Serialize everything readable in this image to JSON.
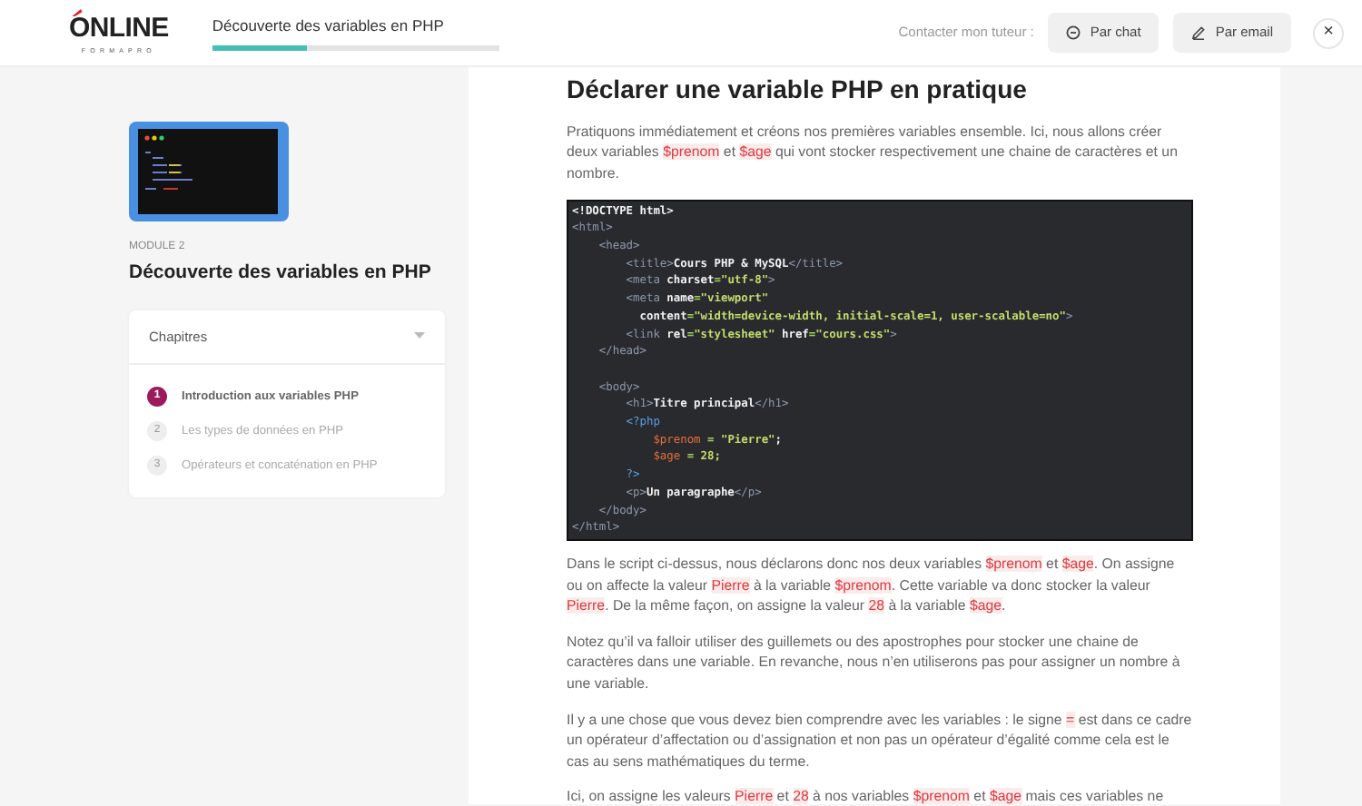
{
  "header": {
    "logo": {
      "word": "ONLINE",
      "tagline": "FORMAPRO"
    },
    "course_title": "Découverte des variables en PHP",
    "progress": {
      "level": 0.33
    },
    "contact_label": "Contacter mon tuteur :",
    "buttons": [
      {
        "kind": "chat",
        "label": "Par chat"
      },
      {
        "kind": "email",
        "label": "Par email"
      }
    ],
    "close": "×"
  },
  "sidebar": {
    "module_label": "MODULE 2",
    "module_title": "Découverte des variables en PHP",
    "chapters": {
      "title": "Chapitres",
      "expanded": true,
      "items": [
        {
          "number": "1",
          "label": "Introduction aux variables PHP",
          "selected": true
        },
        {
          "number": "2",
          "label": "Les types de données en PHP",
          "selected": false
        },
        {
          "number": "3",
          "label": "Opérateurs et concaténation en PHP",
          "selected": false
        }
      ]
    }
  },
  "article": {
    "heading": "Déclarer une variable PHP en pratique",
    "blocks": [
      {
        "kind": "paragraph",
        "parts": [
          {
            "kind": "text",
            "text": "Pratiquons immédiatement et créons nos premières variables ensemble. Ici, nous allons créer deux variables "
          },
          {
            "kind": "code",
            "text": "$prenom"
          },
          {
            "kind": "text",
            "text": " et "
          },
          {
            "kind": "code",
            "text": "$age"
          },
          {
            "kind": "text",
            "text": " qui vont stocker respectivement une chaine de caractères et un nombre."
          }
        ]
      },
      {
        "kind": "code",
        "lines": [
          [
            {
              "kind": "plain",
              "text": "<!DOCTYPE html>"
            }
          ],
          [
            {
              "kind": "tag",
              "text": "<html>"
            }
          ],
          [
            {
              "kind": "tag",
              "text": "    <head>"
            }
          ],
          [
            {
              "kind": "tag",
              "text": "        <title>"
            },
            {
              "kind": "plain",
              "text": "Cours PHP & MySQL"
            },
            {
              "kind": "tag",
              "text": "</title>"
            }
          ],
          [
            {
              "kind": "tag",
              "text": "        <meta "
            },
            {
              "kind": "plain",
              "text": "charset"
            },
            {
              "kind": "punct",
              "text": "="
            },
            {
              "kind": "string",
              "text": "\"utf-8\""
            },
            {
              "kind": "tag",
              "text": ">"
            }
          ],
          [
            {
              "kind": "tag",
              "text": "        <meta "
            },
            {
              "kind": "plain",
              "text": "name"
            },
            {
              "kind": "punct",
              "text": "="
            },
            {
              "kind": "string",
              "text": "\"viewport\""
            }
          ],
          [
            {
              "kind": "plain",
              "text": "          content"
            },
            {
              "kind": "punct",
              "text": "="
            },
            {
              "kind": "string",
              "text": "\"width=device-width, initial-scale=1, user-scalable=no\""
            },
            {
              "kind": "tag",
              "text": ">"
            }
          ],
          [
            {
              "kind": "tag",
              "text": "        <link "
            },
            {
              "kind": "plain",
              "text": "rel"
            },
            {
              "kind": "punct",
              "text": "="
            },
            {
              "kind": "string",
              "text": "\"stylesheet\""
            },
            {
              "kind": "plain",
              "text": " href"
            },
            {
              "kind": "punct",
              "text": "="
            },
            {
              "kind": "string",
              "text": "\"cours.css\""
            },
            {
              "kind": "tag",
              "text": ">"
            }
          ],
          [
            {
              "kind": "tag",
              "text": "    </head>"
            }
          ],
          [
            {
              "kind": "break"
            },
            {
              "kind": "tag",
              "text": "    <body>"
            }
          ],
          [
            {
              "kind": "tag",
              "text": "        <h1>"
            },
            {
              "kind": "plain",
              "text": "Titre principal"
            },
            {
              "kind": "tag",
              "text": "</h1>"
            }
          ],
          [
            {
              "kind": "php",
              "text": "        <?php"
            }
          ],
          [
            {
              "kind": "var",
              "text": "            $prenom"
            },
            {
              "kind": "punct",
              "text": " = "
            },
            {
              "kind": "string",
              "text": "\"Pierre\""
            },
            {
              "kind": "plain",
              "text": ";"
            }
          ],
          [
            {
              "kind": "var",
              "text": "            $age"
            },
            {
              "kind": "punct",
              "text": " = "
            },
            {
              "kind": "string",
              "text": "28;"
            }
          ],
          [
            {
              "kind": "php",
              "text": "        ?>"
            }
          ],
          [
            {
              "kind": "tag",
              "text": "        <p>"
            },
            {
              "kind": "plain",
              "text": "Un paragraphe"
            },
            {
              "kind": "tag",
              "text": "</p>"
            }
          ],
          [
            {
              "kind": "tag",
              "text": "    </body>"
            }
          ],
          [
            {
              "kind": "tag",
              "text": "</html>"
            }
          ]
        ]
      },
      {
        "kind": "paragraph",
        "parts": [
          {
            "kind": "text",
            "text": "Dans le script ci-dessus, nous déclarons donc nos deux variables "
          },
          {
            "kind": "code",
            "text": "$prenom"
          },
          {
            "kind": "text",
            "text": " et "
          },
          {
            "kind": "code",
            "text": "$age"
          },
          {
            "kind": "text",
            "text": ". On assigne ou on affecte la valeur "
          },
          {
            "kind": "code",
            "text": "Pierre"
          },
          {
            "kind": "text",
            "text": " à la variable "
          },
          {
            "kind": "code",
            "text": "$prenom"
          },
          {
            "kind": "text",
            "text": ". Cette variable va donc stocker la valeur "
          },
          {
            "kind": "code",
            "text": "Pierre"
          },
          {
            "kind": "text",
            "text": ". De la même façon, on assigne la valeur "
          },
          {
            "kind": "code",
            "text": "28"
          },
          {
            "kind": "text",
            "text": " à la variable "
          },
          {
            "kind": "code",
            "text": "$age"
          },
          {
            "kind": "text",
            "text": "."
          }
        ]
      },
      {
        "kind": "paragraph",
        "parts": [
          {
            "kind": "text",
            "text": "Notez qu’il va falloir utiliser des guillemets ou des apostrophes pour stocker une chaine de caractères dans une variable. En revanche, nous n’en utiliserons pas pour assigner un nombre à une variable."
          }
        ]
      },
      {
        "kind": "paragraph",
        "parts": [
          {
            "kind": "text",
            "text": "Il y a une chose que vous devez bien comprendre avec les variables : le signe "
          },
          {
            "kind": "code",
            "text": "="
          },
          {
            "kind": "text",
            "text": " est dans ce cadre un opérateur d’affectation ou d’assignation et non pas un opérateur d’égalité comme cela est le cas au sens mathématiques du terme."
          }
        ]
      },
      {
        "kind": "paragraph",
        "parts": [
          {
            "kind": "text",
            "text": "Ici, on assigne les valeurs "
          },
          {
            "kind": "code",
            "text": "Pierre"
          },
          {
            "kind": "text",
            "text": " et "
          },
          {
            "kind": "code",
            "text": "28"
          },
          {
            "kind": "text",
            "text": " à nos variables "
          },
          {
            "kind": "code",
            "text": "$prenom"
          },
          {
            "kind": "text",
            "text": " et "
          },
          {
            "kind": "code",
            "text": "$age"
          },
          {
            "kind": "text",
            "text": " mais ces variables ne"
          }
        ]
      }
    ]
  }
}
